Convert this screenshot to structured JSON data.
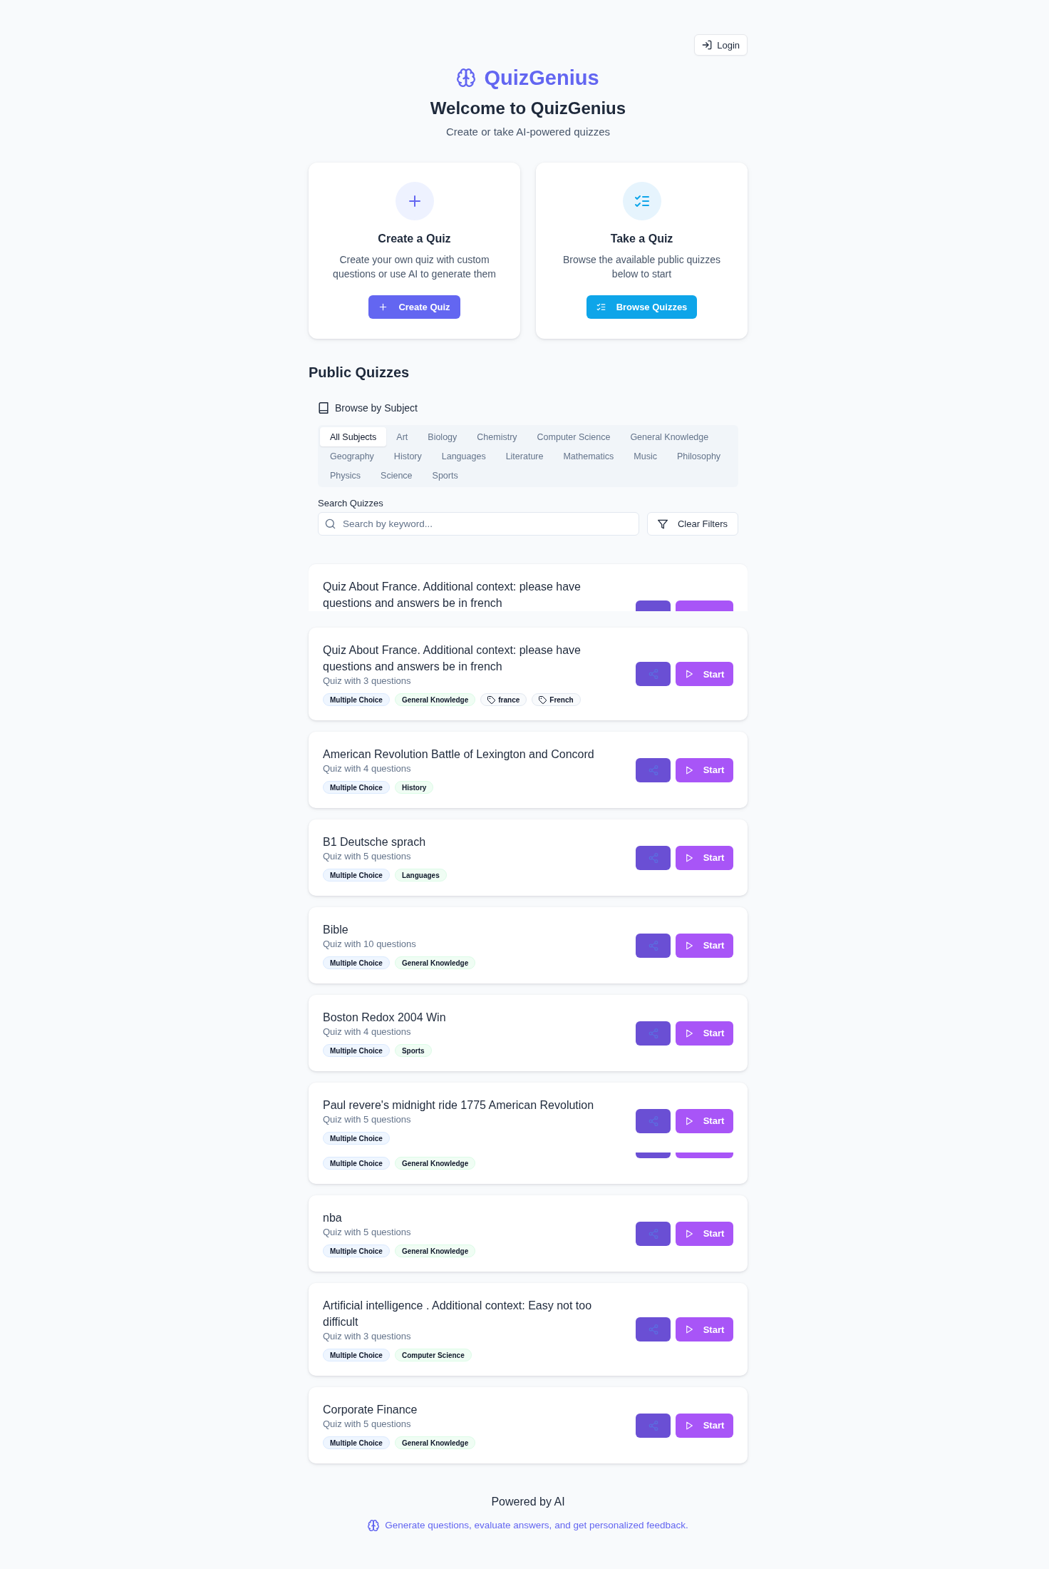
{
  "header": {
    "login": "Login",
    "brand": "QuizGenius",
    "heading": "Welcome to QuizGenius",
    "tagline": "Create or take AI-powered quizzes"
  },
  "actions": [
    {
      "kind": "create",
      "title": "Create a Quiz",
      "description": "Create your own quiz with custom questions or use AI to generate them",
      "button": "Create Quiz"
    },
    {
      "kind": "browse",
      "title": "Take a Quiz",
      "description": "Browse the available public quizzes below to start",
      "button": "Browse Quizzes"
    }
  ],
  "public_quizzes": {
    "title": "Public Quizzes",
    "browse_label": "Browse by Subject",
    "subjects": [
      {
        "label": "All Subjects",
        "selected": true
      },
      {
        "label": "Art",
        "selected": false
      },
      {
        "label": "Biology",
        "selected": false
      },
      {
        "label": "Chemistry",
        "selected": false
      },
      {
        "label": "Computer Science",
        "selected": false
      },
      {
        "label": "General Knowledge",
        "selected": false
      },
      {
        "label": "Geography",
        "selected": false
      },
      {
        "label": "History",
        "selected": false
      },
      {
        "label": "Languages",
        "selected": false
      },
      {
        "label": "Literature",
        "selected": false
      },
      {
        "label": "Mathematics",
        "selected": false
      },
      {
        "label": "Music",
        "selected": false
      },
      {
        "label": "Philosophy",
        "selected": false
      },
      {
        "label": "Physics",
        "selected": false
      },
      {
        "label": "Science",
        "selected": false
      },
      {
        "label": "Sports",
        "selected": false
      }
    ],
    "search": {
      "label": "Search Quizzes",
      "placeholder": "Search by keyword..."
    },
    "clear_button": "Clear Filters"
  },
  "quizzes": [
    {
      "kind": "clipped",
      "title": "Quiz About France. Additional context: please have questions and answers be in french"
    },
    {
      "kind": "card",
      "title": "Quiz About France. Additional context: please have questions and answers be in french",
      "subtitle": "Quiz with 3 questions",
      "tags": [
        {
          "kind": "format",
          "label": "Multiple Choice"
        },
        {
          "kind": "subject",
          "label": "General Knowledge"
        },
        {
          "kind": "keyword",
          "label": "france"
        },
        {
          "kind": "keyword",
          "label": "French"
        }
      ],
      "start": "Start"
    },
    {
      "kind": "card",
      "title": "American Revolution Battle of Lexington and Concord",
      "subtitle": "Quiz with 4 questions",
      "tags": [
        {
          "kind": "format",
          "label": "Multiple Choice"
        },
        {
          "kind": "subject",
          "label": "History"
        }
      ],
      "start": "Start"
    },
    {
      "kind": "card",
      "title": "B1 Deutsche sprach",
      "subtitle": "Quiz with 5 questions",
      "tags": [
        {
          "kind": "format",
          "label": "Multiple Choice"
        },
        {
          "kind": "subject",
          "label": "Languages"
        }
      ],
      "start": "Start"
    },
    {
      "kind": "card",
      "title": "Bible",
      "subtitle": "Quiz with 10 questions",
      "tags": [
        {
          "kind": "format",
          "label": "Multiple Choice"
        },
        {
          "kind": "subject",
          "label": "General Knowledge"
        }
      ],
      "start": "Start"
    },
    {
      "kind": "card",
      "title": "Boston Redox 2004 Win",
      "subtitle": "Quiz with 4 questions",
      "tags": [
        {
          "kind": "format",
          "label": "Multiple Choice"
        },
        {
          "kind": "subject",
          "label": "Sports"
        }
      ],
      "start": "Start"
    },
    {
      "kind": "card",
      "title": "Paul revere's midnight ride 1775 American Revolution",
      "subtitle": "Quiz with 5 questions",
      "tags": [
        {
          "kind": "format",
          "label": "Multiple Choice"
        }
      ],
      "start": "Start",
      "overlap": {
        "tags": [
          {
            "kind": "format",
            "label": "Multiple Choice"
          },
          {
            "kind": "subject",
            "label": "General Knowledge"
          }
        ]
      }
    },
    {
      "kind": "card",
      "title": "nba",
      "subtitle": "Quiz with 5 questions",
      "tags": [
        {
          "kind": "format",
          "label": "Multiple Choice"
        },
        {
          "kind": "subject",
          "label": "General Knowledge"
        }
      ],
      "start": "Start"
    },
    {
      "kind": "card",
      "title": "Artificial intelligence . Additional context: Easy not too difficult",
      "subtitle": "Quiz with 3 questions",
      "tags": [
        {
          "kind": "format",
          "label": "Multiple Choice"
        },
        {
          "kind": "subject",
          "label": "Computer Science"
        }
      ],
      "start": "Start"
    },
    {
      "kind": "card",
      "title": "Corporate Finance",
      "subtitle": "Quiz with 5 questions",
      "tags": [
        {
          "kind": "format",
          "label": "Multiple Choice"
        },
        {
          "kind": "subject",
          "label": "General Knowledge"
        }
      ],
      "start": "Start"
    }
  ],
  "footer": {
    "title": "Powered by AI",
    "note": "Generate questions, evaluate answers, and get personalized feedback."
  }
}
